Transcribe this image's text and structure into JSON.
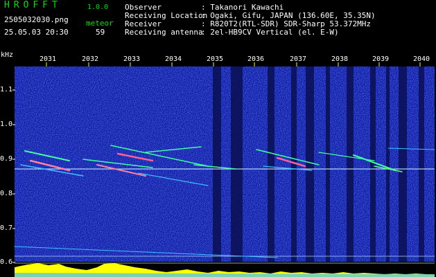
{
  "app": {
    "title": "HROFFT",
    "version": "1.0.0"
  },
  "file": {
    "name": "2505032030.png",
    "datetime": "25.05.03 20:30"
  },
  "meteor": {
    "label": "meteor",
    "count": "59"
  },
  "info": [
    {
      "key": "Observer",
      "value": ": Takanori Kawachi"
    },
    {
      "key": "Receiving Location",
      "value": ": Ogaki, Gifu, JAPAN (136.60E, 35.35N)"
    },
    {
      "key": "Receiver",
      "value": ": R820T2(RTL-SDR) SDR-Sharp 53.372MHz"
    },
    {
      "key": "Receiving antenna",
      "value": ": 2el-HB9CV Vertical (el. E-W)"
    }
  ],
  "axis": {
    "y_unit": "kHz",
    "y_ticks": [
      "1.1",
      "1.0",
      "0.9",
      "0.8",
      "0.7",
      "0.6"
    ],
    "x_ticks": [
      "2031",
      "2032",
      "2033",
      "2034",
      "2035",
      "2036",
      "2037",
      "2038",
      "2039",
      "2040"
    ]
  },
  "colors": {
    "background": "#000000",
    "spectrum_noise": "#1a2ad0",
    "header_green": "#00e000",
    "header_white": "#ffffff",
    "tick_yellow": "#ffff00",
    "meteor_trace": "#40ffa0",
    "carrier_line": "#c0e8ff"
  }
}
